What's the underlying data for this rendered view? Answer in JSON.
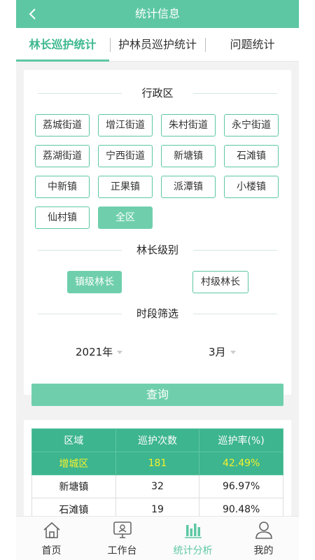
{
  "header": {
    "title": "统计信息"
  },
  "tabs": [
    {
      "label": "林长巡护统计",
      "active": true
    },
    {
      "label": "护林员巡护统计",
      "active": false
    },
    {
      "label": "问题统计",
      "active": false
    }
  ],
  "district_section": {
    "title": "行政区"
  },
  "districts": [
    "荔城街道",
    "增江街道",
    "朱村街道",
    "永宁街道",
    "荔湖街道",
    "宁西街道",
    "新塘镇",
    "石滩镇",
    "中新镇",
    "正果镇",
    "派潭镇",
    "小楼镇",
    "仙村镇",
    "全区"
  ],
  "selected_district": "全区",
  "level_section": {
    "title": "林长级别"
  },
  "levels": [
    {
      "label": "镇级林长",
      "selected": true
    },
    {
      "label": "村级林长",
      "selected": false
    }
  ],
  "period_section": {
    "title": "时段筛选"
  },
  "period": {
    "year": "2021年",
    "month": "3月"
  },
  "query_button": "查询",
  "table": {
    "headers": [
      "区域",
      "巡护次数",
      "巡护率(%)"
    ],
    "rows": [
      [
        "增城区",
        "181",
        "42.49%"
      ],
      [
        "新塘镇",
        "32",
        "96.97%"
      ],
      [
        "石滩镇",
        "19",
        "90.48%"
      ]
    ]
  },
  "bottom_nav": [
    {
      "label": "首页",
      "icon": "home-icon",
      "active": false
    },
    {
      "label": "工作台",
      "icon": "workbench-icon",
      "active": false
    },
    {
      "label": "统计分析",
      "icon": "bar-chart-icon",
      "active": true
    },
    {
      "label": "我的",
      "icon": "user-icon",
      "active": false
    }
  ],
  "colors": {
    "accent": "#5dc7a4",
    "selected": "#6fcfac",
    "table_header": "#3db58e",
    "highlight_text": "#f4f02e"
  }
}
